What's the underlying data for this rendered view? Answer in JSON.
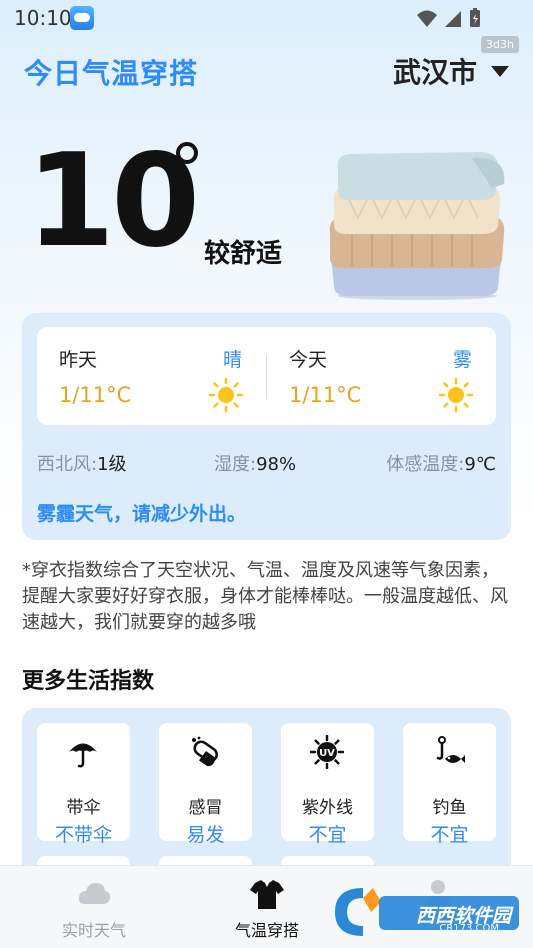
{
  "status_bar": {
    "time": "10:10",
    "badge": "3d3h"
  },
  "header": {
    "title": "今日气温穿搭",
    "city": "武汉市"
  },
  "current": {
    "temperature": "10",
    "comfort": "较舒适"
  },
  "forecast": {
    "yesterday": {
      "day": "昨天",
      "condition": "晴",
      "range": "1/11°C",
      "icon": "sun-icon"
    },
    "today": {
      "day": "今天",
      "condition": "雾",
      "range": "1/11°C",
      "icon": "sun-icon"
    }
  },
  "metrics": {
    "wind_label": "西北风:",
    "wind_value": "1级",
    "humidity_label": "湿度:",
    "humidity_value": "98%",
    "feels_label": "体感温度:",
    "feels_value": "9℃"
  },
  "tip": "雾霾天气，请减少外出。",
  "note": "*穿衣指数综合了天空状况、气温、温度及风速等气象因素，提醒大家要好好穿衣服，身体才能棒棒哒。一般温度越低、风速越大，我们就要穿的越多哦",
  "more_section": {
    "title": "更多生活指数",
    "items": [
      {
        "name": "带伞",
        "value": "不带伞",
        "icon": "umbrella-icon"
      },
      {
        "name": "感冒",
        "value": "易发",
        "icon": "pill-icon"
      },
      {
        "name": "紫外线",
        "value": "不宜",
        "icon": "uv-icon"
      },
      {
        "name": "钓鱼",
        "value": "不宜",
        "icon": "fishing-icon"
      }
    ]
  },
  "bottom_nav": {
    "items": [
      {
        "label": "实时天气",
        "icon": "cloud-icon"
      },
      {
        "label": "气温穿搭",
        "icon": "tshirt-icon"
      },
      {
        "label": "",
        "icon": "person-icon"
      }
    ]
  },
  "watermark": {
    "text": "西西软件园",
    "sub": "CR173.COM"
  },
  "colors": {
    "accent": "#2f8cf2",
    "temp": "#f0a020",
    "card_bg": "#dcecfb"
  }
}
